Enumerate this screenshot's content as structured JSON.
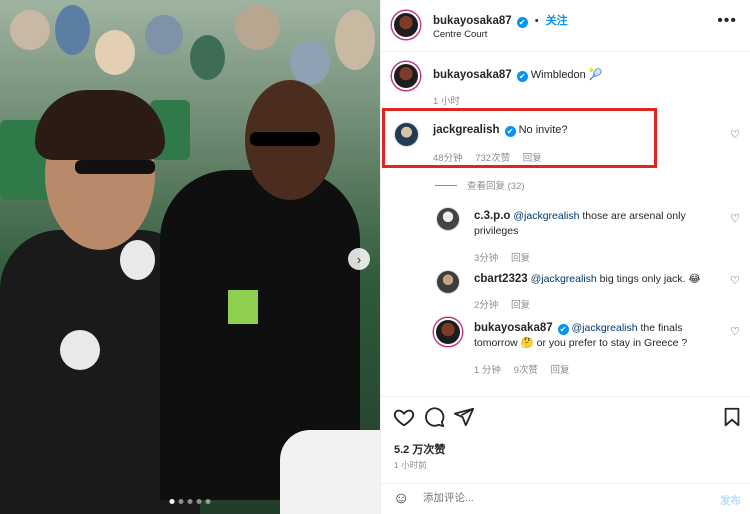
{
  "post": {
    "author": "bukayosaka87",
    "separator": "•",
    "follow_label": "关注",
    "location": "Centre Court",
    "caption": "Wimbledon 🎾",
    "caption_time": "1 小时"
  },
  "comments": [
    {
      "user": "jackgrealish",
      "verified": true,
      "mention": "",
      "text": "No invite?",
      "time": "48分钟",
      "likes": "732次赞",
      "reply": "回复"
    },
    {
      "user": "c.3.p.o",
      "verified": false,
      "mention": "@jackgrealish",
      "text": " those are arsenal only privileges",
      "time": "3分钟",
      "likes": "",
      "reply": "回复"
    },
    {
      "user": "cbart2323",
      "verified": false,
      "mention": "@jackgrealish",
      "text": " big tings only jack. 😂",
      "time": "2分钟",
      "likes": "",
      "reply": "回复"
    },
    {
      "user": "bukayosaka87",
      "verified": true,
      "mention": "@jackgrealish",
      "text": " the finals tomorrow 🤔 or you prefer to stay in Greece ?",
      "time": "1 分钟",
      "likes": "9次赞",
      "reply": "回复"
    }
  ],
  "view_replies": "查看回复 (32)",
  "actions": {
    "likes": "5.2 万次赞",
    "time": "1 小时前"
  },
  "comment_box": {
    "placeholder": "添加评论...",
    "post_label": "发布"
  },
  "icons": {
    "verified": "✔",
    "more": "•••",
    "heart": "♡",
    "next": "›",
    "emoji": "☺"
  },
  "colors": {
    "verified": "#0095f6",
    "highlight": "#e02424",
    "link": "#00376b"
  }
}
